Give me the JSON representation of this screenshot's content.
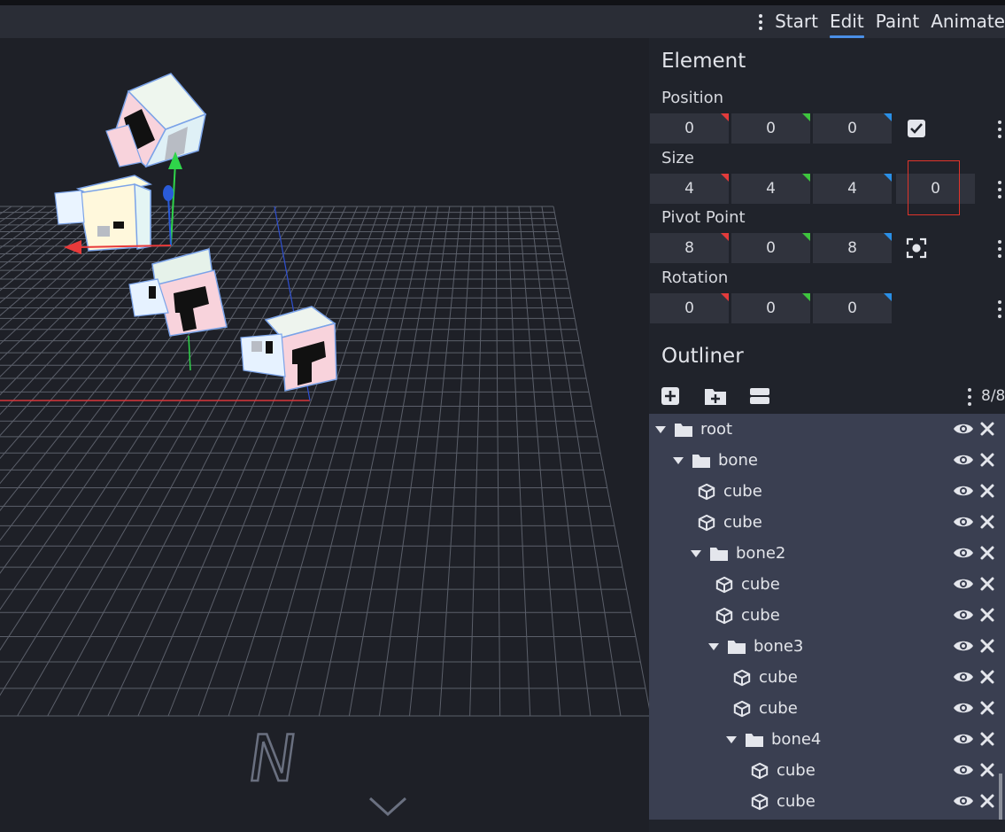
{
  "toolbar": {
    "modes": [
      {
        "label": "Start",
        "active": false
      },
      {
        "label": "Edit",
        "active": true
      },
      {
        "label": "Paint",
        "active": false
      },
      {
        "label": "Animate",
        "active": false
      }
    ],
    "accent_color": "#4a8fe6"
  },
  "element_panel": {
    "title": "Element",
    "position": {
      "label": "Position",
      "values": [
        "0",
        "0",
        "0"
      ]
    },
    "size": {
      "label": "Size",
      "values": [
        "4",
        "4",
        "4"
      ],
      "inflate": "0"
    },
    "pivot": {
      "label": "Pivot Point",
      "values": [
        "8",
        "0",
        "8"
      ]
    },
    "rotation": {
      "label": "Rotation",
      "values": [
        "0",
        "0",
        "0"
      ]
    },
    "axis_colors": {
      "x": "#e23b3b",
      "y": "#3ec43e",
      "z": "#2a8fe6"
    }
  },
  "outliner": {
    "title": "Outliner",
    "count": "8/8",
    "tools": [
      "add-cube-icon",
      "add-group-icon",
      "collapse-icon"
    ],
    "nodes": [
      {
        "label": "root",
        "type": "group",
        "depth": 0
      },
      {
        "label": "bone",
        "type": "group",
        "depth": 1
      },
      {
        "label": "cube",
        "type": "cube",
        "depth": 2
      },
      {
        "label": "cube",
        "type": "cube",
        "depth": 2
      },
      {
        "label": "bone2",
        "type": "group",
        "depth": 2
      },
      {
        "label": "cube",
        "type": "cube",
        "depth": 3
      },
      {
        "label": "cube",
        "type": "cube",
        "depth": 3
      },
      {
        "label": "bone3",
        "type": "group",
        "depth": 3
      },
      {
        "label": "cube",
        "type": "cube",
        "depth": 4
      },
      {
        "label": "cube",
        "type": "cube",
        "depth": 4
      },
      {
        "label": "bone4",
        "type": "group",
        "depth": 4
      },
      {
        "label": "cube",
        "type": "cube",
        "depth": 5
      },
      {
        "label": "cube",
        "type": "cube",
        "depth": 5
      }
    ]
  },
  "viewport": {
    "compass_label": "N"
  }
}
